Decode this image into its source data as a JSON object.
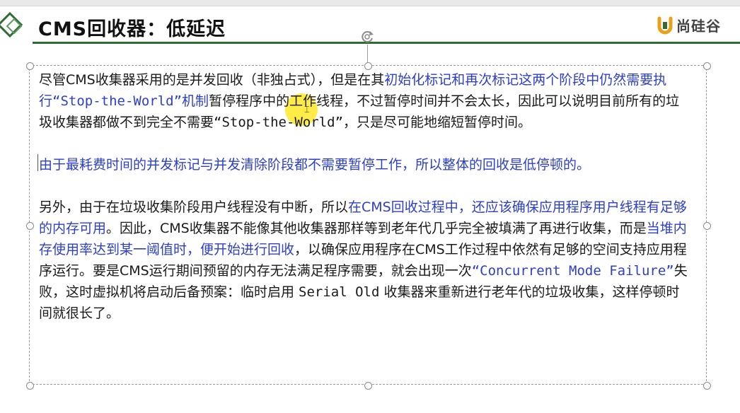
{
  "slide": {
    "title": "CMS回收器：低延迟",
    "logo_text": "尚硅谷"
  },
  "paragraph1": {
    "seg1": "尽管CMS收集器采用的是并发回收（非独占式），但是在其",
    "seg2": "初始化标记和再次标记这两个阶段中仍然需要执行",
    "seg3": "“Stop-the-World”",
    "seg4": "机制",
    "seg5": "暂停程序中的工作线程，不过暂停时间并不会太长，因此可以说明目前所有的垃圾收集器都做不到完全不需要",
    "seg6": "“Stop-the-World”",
    "seg7": "，只是尽可能地缩短暂停时间。"
  },
  "paragraph2": {
    "text": "由于最耗费时间的并发标记与并发清除阶段都不需要暂停工作，所以整体的回收是低停顿的。"
  },
  "paragraph3": {
    "seg1": "另外，由于在垃圾收集阶段用户线程没有中断，所以",
    "seg2": "在CMS回收过程中，还应该确保应用程序用户线程有足够的内存可用",
    "seg3": "。因此，CMS收集器不能像其他收集器那样等到老年代几乎完全被填满了再进行收集，而是",
    "seg4": "当堆内存使用率达到某一阈值时，便开始进行回收",
    "seg5": "，以确保应用程序在CMS工作过程中依然有足够的空间支持应用程序运行。要是CMS运行期间预留的内存无法满足程序需要，就会出现一次",
    "seg6": "“Concurrent Mode Failure”",
    "seg7": "失败，这时虚拟机将启动后备预案：临时启用 ",
    "seg8": "Serial Old",
    "seg9": " 收集器来重新进行老年代的垃圾收集，这样停顿时间就很长了。"
  },
  "colors": {
    "accent_blue": "#2d3fc8",
    "header_line": "#2f6b33",
    "pointer_highlight": "#ffe400",
    "logo_orange": "#e8a11c"
  },
  "icons": {
    "corner": "diamond-deco-icon",
    "logo": "shanggu-logo-icon",
    "rotate": "rotate-handle-icon"
  }
}
